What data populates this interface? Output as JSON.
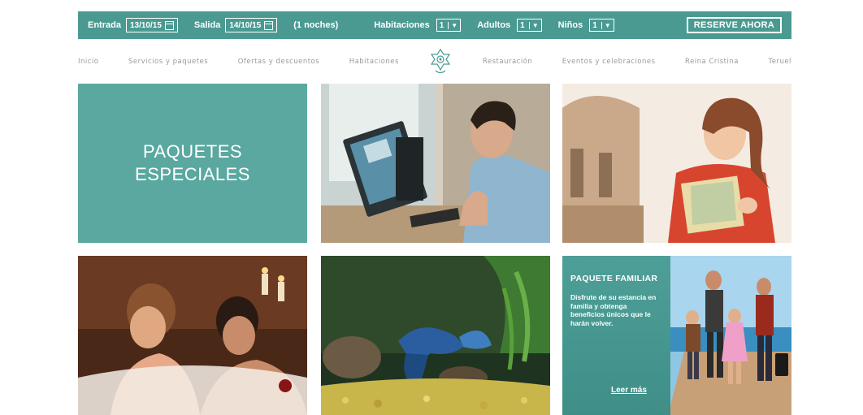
{
  "booking": {
    "checkin_label": "Entrada",
    "checkin_value": "13/10/15",
    "checkout_label": "Salida",
    "checkout_value": "14/10/15",
    "nights": "(1 noches)",
    "rooms_label": "Habitaciones",
    "rooms_value": "1",
    "adults_label": "Adultos",
    "adults_value": "1",
    "children_label": "Niños",
    "children_value": "1",
    "reserve_label": "RESERVE AHORA"
  },
  "nav": {
    "items": [
      "Inicio",
      "Servicios y paquetes",
      "Ofertas y descuentos",
      "Habitaciones",
      "Restauración",
      "Eventos y celebraciones",
      "Reina Cristina",
      "Teruel"
    ]
  },
  "tiles": {
    "promo": {
      "line1": "PAQUETES",
      "line2": "ESPECIALES"
    },
    "family": {
      "title": "PAQUETE FAMILIAR",
      "text": "Disfrute de su estancia en familia y obtenga beneficios únicos que le harán volver.",
      "link": "Leer más"
    }
  },
  "colors": {
    "accent": "#4a9a92",
    "promo_bg": "#5aa8a0",
    "nav_text": "#9a9a9a"
  },
  "icons": [
    "calendar-icon",
    "chevron-down-icon",
    "hotel-logo-icon"
  ]
}
